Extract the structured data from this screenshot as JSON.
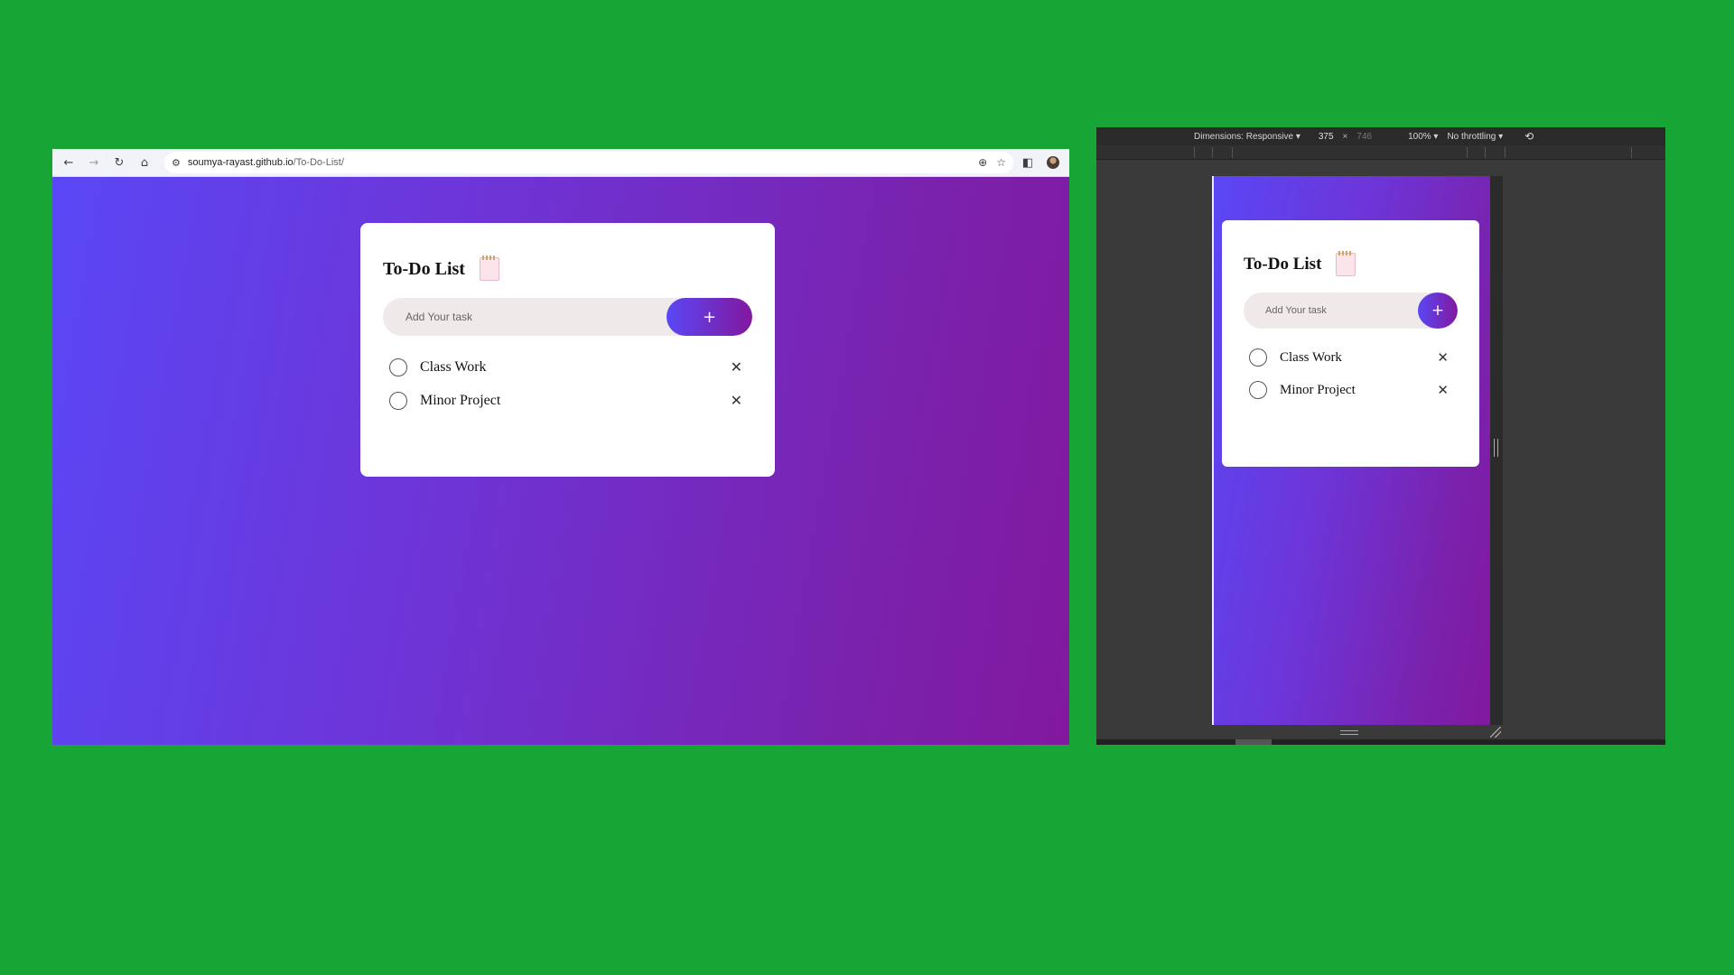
{
  "browser": {
    "url_host": "soumya-rayast.github.io",
    "url_path": "/To-Do-List/",
    "back_icon": "←",
    "forward_icon": "→",
    "reload_icon": "↻",
    "home_icon": "⌂",
    "site_settings_icon": "⚙",
    "zoom_icon": "⊕",
    "star_icon": "☆",
    "sidepanel_icon": "◧"
  },
  "app": {
    "title": "To-Do List",
    "input_placeholder": "Add Your task",
    "add_label": "+",
    "tasks": [
      {
        "label": "Class Work",
        "remove": "✕"
      },
      {
        "label": "Minor Project",
        "remove": "✕"
      }
    ]
  },
  "devtools": {
    "dimensions_label": "Dimensions: Responsive ▾",
    "width": "375",
    "times": "×",
    "height": "746",
    "zoom": "100% ▾",
    "throttling": "No throttling ▾",
    "rotate_icon": "⟲"
  },
  "colors": {
    "background": "#17a535",
    "gradient_start": "#5a47f5",
    "gradient_end": "#82189f",
    "input_bg": "#efe9ea"
  }
}
